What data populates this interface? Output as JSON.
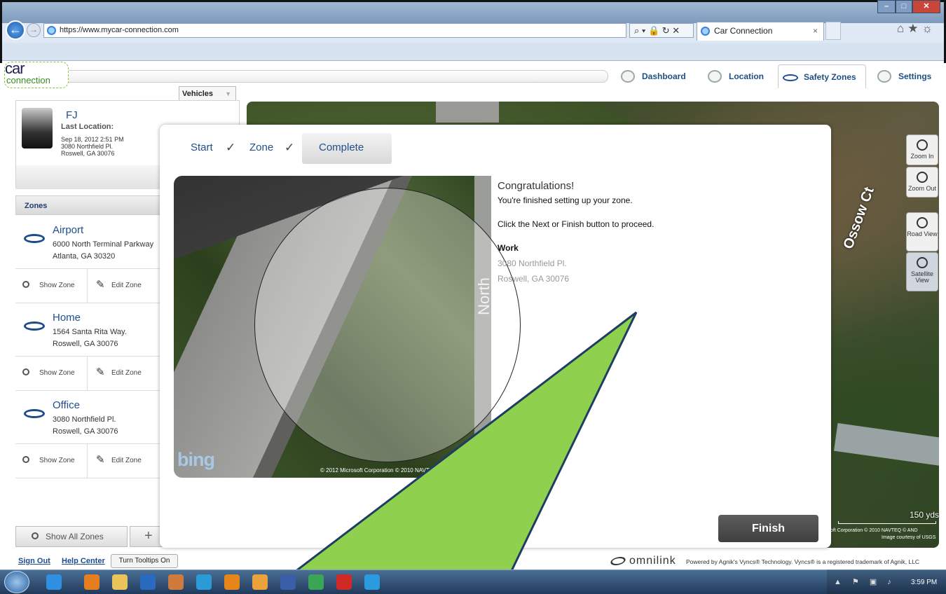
{
  "browser": {
    "url": "https://www.mycar-connection.com",
    "url_controls": "⌕ ▾ 🔒 ↻ ✕",
    "tab_title": "Car Connection",
    "tab_close": "×"
  },
  "app": {
    "logo_top": "car",
    "logo_bottom": "connection",
    "nav": [
      {
        "label": "Dashboard",
        "icon": "steering-wheel-icon"
      },
      {
        "label": "Location",
        "icon": "location-pin-icon"
      },
      {
        "label": "Safety Zones",
        "icon": "zone-ring-icon",
        "active": true
      },
      {
        "label": "Settings",
        "icon": "gear-icon"
      }
    ]
  },
  "vehicles": {
    "tab_label": "Vehicles",
    "vehicle": {
      "name": "FJ",
      "last_location_label": "Last Location:",
      "timestamp": "Sep 18, 2012 2:51 PM",
      "address_line1": "3080 Northfield Pl.",
      "address_line2": "Roswell, GA 30076"
    }
  },
  "zones": {
    "header": "Zones",
    "show_label": "Show Zone",
    "edit_label": "Edit Zone",
    "items": [
      {
        "name": "Airport",
        "line1": "6000 North Terminal Parkway",
        "line2": "Atlanta, GA 30320"
      },
      {
        "name": "Home",
        "line1": "1564 Santa Rita Way.",
        "line2": "Roswell, GA 30076"
      },
      {
        "name": "Office",
        "line1": "3080 Northfield Pl.",
        "line2": "Roswell, GA 30076"
      }
    ],
    "show_all": "Show All Zones",
    "add": "+"
  },
  "map": {
    "zoom_in": "Zoom In",
    "zoom_out": "Zoom Out",
    "road_view": "Road View",
    "satellite_view": "Satellite View",
    "road_name": "Ossow Ct",
    "scale": "150 yds",
    "copyright1": "oft Corporation  © 2010 NAVTEQ  © AND",
    "copyright2": "Image courtesy of USGS"
  },
  "wizard": {
    "steps": [
      "Start",
      "Zone",
      "Complete"
    ],
    "check": "✓",
    "preview_road": "North",
    "preview_logo": "bing",
    "preview_copyright": "© 2012 Microsoft Corporation  © 2010 NAVTEQ  © AND",
    "congrats": "Congratulations!",
    "finished": "You're finished setting up your zone.",
    "instruction": "Click the Next or Finish button to proceed.",
    "zone_name": "Work",
    "zone_addr1": "3080 Northfield Pl.",
    "zone_addr2": "Roswell, GA 30076",
    "finish": "Finish"
  },
  "footer": {
    "sign_out": "Sign Out",
    "help_center": "Help Center",
    "tooltips": "Turn Tooltips On",
    "brand": "omnilink",
    "powered": "Powered by Agnik's Vyncs® Technology. Vyncs® is a registered trademark of Agnik, LLC"
  },
  "taskbar": {
    "clock": "3:59 PM"
  },
  "colors": {
    "accent": "#1e4f8c",
    "callout": "#8fd14f"
  }
}
